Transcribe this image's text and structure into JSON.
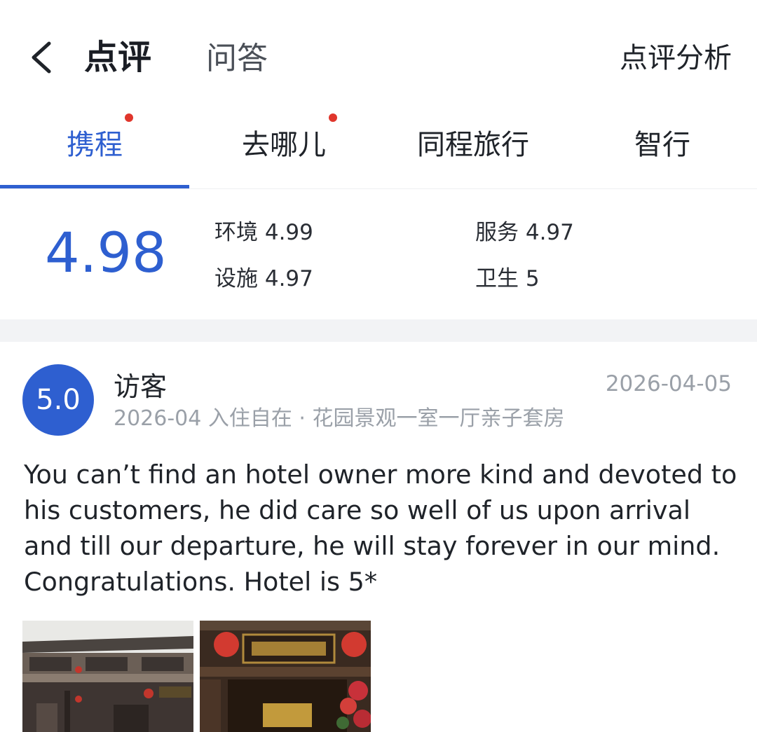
{
  "header": {
    "back_icon": "chevron-left-icon",
    "tab_review": "点评",
    "tab_qa": "问答",
    "analysis": "点评分析"
  },
  "source_tabs": [
    {
      "label": "携程",
      "active": true,
      "dot": true
    },
    {
      "label": "去哪儿",
      "active": false,
      "dot": true
    },
    {
      "label": "同程旅行",
      "active": false,
      "dot": false
    },
    {
      "label": "智行",
      "active": false,
      "dot": false
    }
  ],
  "scores": {
    "overall": "4.98",
    "environment": "环境 4.99",
    "service": "服务 4.97",
    "facilities": "设施 4.97",
    "hygiene": "卫生 5"
  },
  "review": {
    "rating": "5.0",
    "reviewer": "访客",
    "date": "2026-04-05",
    "meta": "2026-04 入住自在 · 花园景观一室一厅亲子套房",
    "body": "You can’t find an hotel owner more kind and devoted to his customers, he did care so well of us upon arrival and till our departure, he will stay forever in our mind. Congratulations. Hotel is 5*"
  },
  "colors": {
    "accent": "#2e5fd0",
    "dot": "#e0362c",
    "muted": "#9aa0a8"
  }
}
